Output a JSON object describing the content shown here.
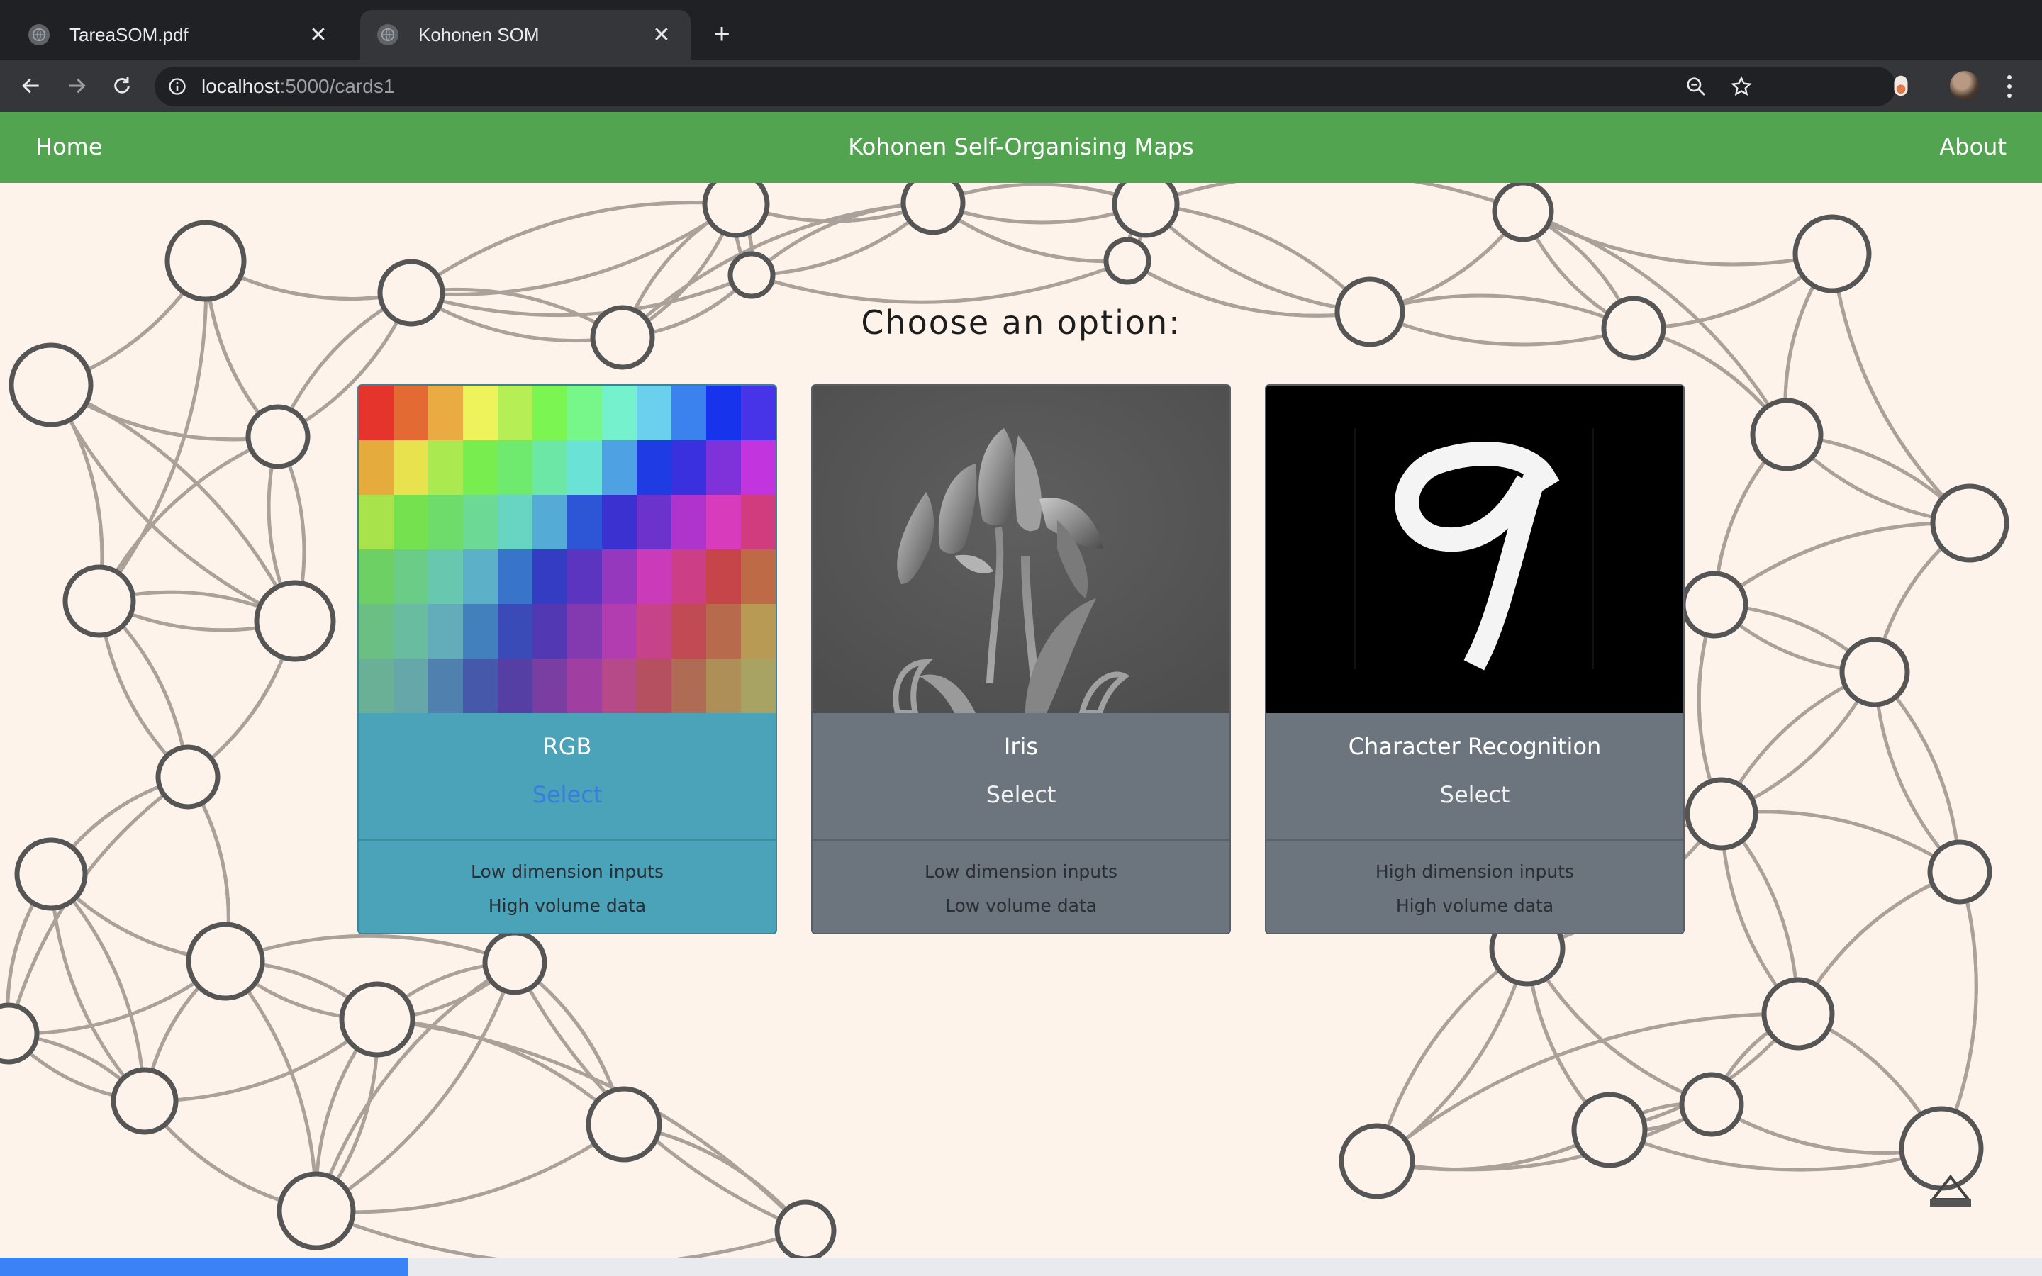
{
  "browser": {
    "tabs": [
      {
        "title": "TareaSOM.pdf",
        "active": false,
        "favicon": "globe-icon"
      },
      {
        "title": "Kohonen SOM",
        "active": true,
        "favicon": "globe-icon"
      }
    ],
    "close_glyph": "✕",
    "new_tab_glyph": "+",
    "url_host": "localhost",
    "url_path": ":5000/cards1",
    "toolbar_icons": [
      "back-icon",
      "forward-icon",
      "reload-icon",
      "info-icon",
      "zoom-icon",
      "star-icon",
      "extension-icon",
      "avatar",
      "menu-icon"
    ]
  },
  "navbar": {
    "home": "Home",
    "title": "Kohonen Self-Organising Maps",
    "about": "About",
    "color": "#53a450"
  },
  "heading": "Choose an option:",
  "cards": [
    {
      "title": "RGB",
      "select": "Select",
      "line1": "Low dimension inputs",
      "line2": "High volume data",
      "color": "#4aa3b8",
      "image": "rgb-color-grid"
    },
    {
      "title": "Iris",
      "select": "Select",
      "line1": "Low dimension inputs",
      "line2": "Low volume data",
      "color": "#6c757d",
      "image": "iris-flower-image"
    },
    {
      "title": "Character Recognition",
      "select": "Select",
      "line1": "High dimension inputs",
      "line2": "High volume data",
      "color": "#6c757d",
      "image": "handwritten-digit-image"
    }
  ],
  "rgb_grid_colors": [
    [
      "#e4342b",
      "#e36b33",
      "#eaac42",
      "#eef25b",
      "#b5ef55",
      "#7bf552",
      "#77f68a",
      "#75f1ce",
      "#6ad0ee",
      "#3b82ee",
      "#1734ec",
      "#4733e8",
      "#8e34e7",
      "#db3ae9",
      "#e23e9c"
    ],
    [
      "#e2672f",
      "#e6ab3d",
      "#e8e24f",
      "#abe950",
      "#77ed4f",
      "#6fea6e",
      "#6de7a5",
      "#6ae3d6",
      "#4ea2e3",
      "#1f3be2",
      "#3b30de",
      "#7f32d9",
      "#c234dd",
      "#e03ac0",
      "#d53c6c"
    ],
    [
      "#d9a13c",
      "#dde14c",
      "#a9e34c",
      "#76e14e",
      "#6ddc6a",
      "#6cda94",
      "#68d5c3",
      "#54abd6",
      "#2d56d6",
      "#3a31d0",
      "#6c33cc",
      "#af34cb",
      "#d83bbb",
      "#d13c7e",
      "#c8423e"
    ],
    [
      "#cdcf4c",
      "#a3d64c",
      "#78d44e",
      "#6dd065",
      "#6bcc88",
      "#68c8af",
      "#5cb0c8",
      "#3874c9",
      "#343cc4",
      "#5b35bf",
      "#9638bd",
      "#c93bb8",
      "#cc3e86",
      "#c54549",
      "#bf6a46"
    ],
    [
      "#9fc84c",
      "#7cc74f",
      "#6fc366",
      "#6bbf82",
      "#69bca0",
      "#62adb9",
      "#4280bb",
      "#3a4bb8",
      "#5239b3",
      "#8339b0",
      "#b23db0",
      "#c64389",
      "#c04b55",
      "#b86a4d",
      "#b99a54"
    ],
    [
      "#7cb94f",
      "#71b666",
      "#6cb27c",
      "#6ab096",
      "#66a8aa",
      "#5080ae",
      "#4558aa",
      "#553fa5",
      "#7a3da2",
      "#a03fa1",
      "#b64987",
      "#b55061",
      "#b06b54",
      "#ae8f58",
      "#a9a363"
    ]
  ],
  "progress": 0.2
}
